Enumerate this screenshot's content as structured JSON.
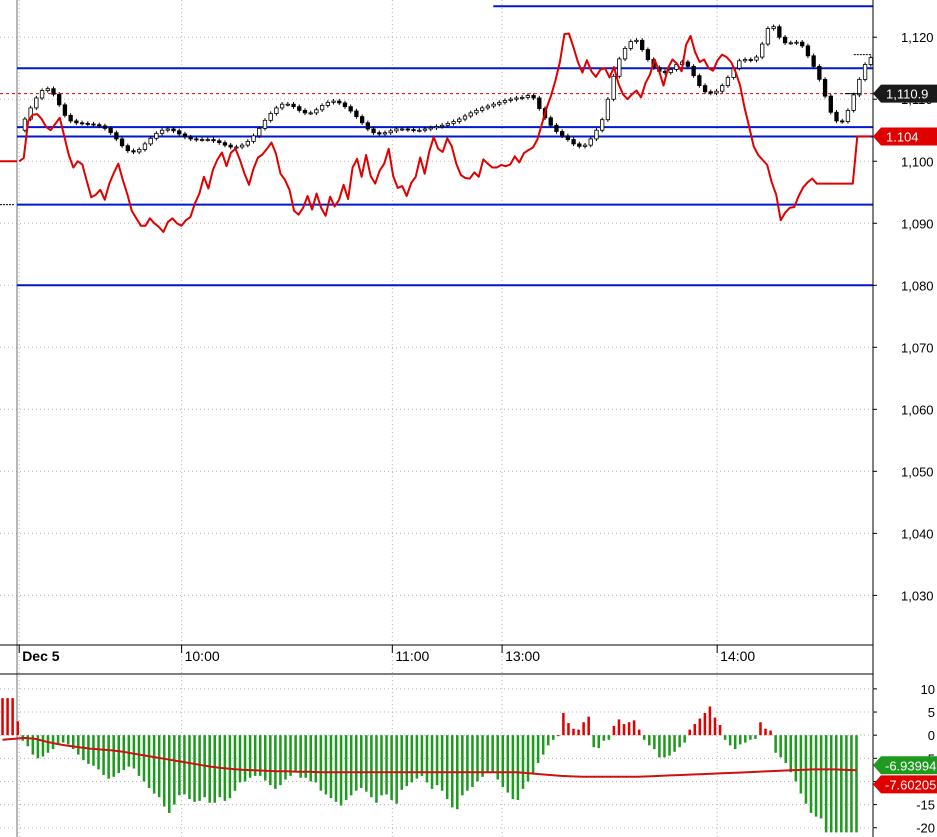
{
  "colors": {
    "background": "#ffffff",
    "grid": "#b8b8b8",
    "level_line": "#0018d0",
    "overlay_line": "#e00000",
    "candle_up": "#ffffff",
    "candle_down": "#000000",
    "histogram_positive": "#e00000",
    "histogram_negative": "#1e9a1e",
    "signal_line": "#d01010",
    "badge_dark": "#1a1a1a",
    "badge_red": "#e00000",
    "badge_green": "#1e9a1e",
    "text": "#000000"
  },
  "chart_data": [
    {
      "type": "candlestick",
      "panel": "price",
      "title": "",
      "xlabel": "",
      "ylabel": "",
      "ylim": [
        1022,
        1126
      ],
      "grid": true,
      "y_ticks": [
        1030,
        1040,
        1050,
        1060,
        1070,
        1080,
        1090,
        1100,
        1110,
        1120
      ],
      "y_tick_labels": [
        "1,030",
        "1,040",
        "1,050",
        "1,060",
        "1,070",
        "1,080",
        "1,090",
        "1,100",
        "1,110",
        "1,120"
      ],
      "x_tick_labels": [
        {
          "label": "Dec 5",
          "bar": 0
        },
        {
          "label": "10:00",
          "bar": 37
        },
        {
          "label": "11:00",
          "bar": 85
        },
        {
          "label": "13:00",
          "bar": 110
        },
        {
          "label": "14:00",
          "bar": 159
        }
      ],
      "bar_count": 195,
      "candles": {
        "bar_start": 0,
        "values": [
          1105.0,
          1106.8,
          1108.6,
          1110.2,
          1111.4,
          1111.7,
          1110.8,
          1109.1,
          1107.4,
          1106.5,
          1106.2,
          1106.1,
          1106.0,
          1105.9,
          1105.7,
          1105.3,
          1104.6,
          1103.6,
          1102.5,
          1101.7,
          1101.5,
          1101.9,
          1102.8,
          1103.7,
          1104.5,
          1105.0,
          1105.2,
          1104.9,
          1104.4,
          1103.9,
          1103.6,
          1103.5,
          1103.5,
          1103.5,
          1103.3,
          1103.0,
          1102.6,
          1102.3,
          1102.3,
          1102.6,
          1103.2,
          1104.1,
          1105.3,
          1106.6,
          1107.7,
          1108.6,
          1109.2,
          1109.2,
          1108.8,
          1108.2,
          1107.8,
          1107.8,
          1108.3,
          1109.0,
          1109.5,
          1109.7,
          1109.4,
          1108.8,
          1108.1,
          1107.2,
          1106.2,
          1105.2,
          1104.6,
          1104.4,
          1104.6,
          1104.9,
          1105.2,
          1105.2,
          1105.1,
          1105.0,
          1105.0,
          1105.2,
          1105.4,
          1105.6,
          1105.8,
          1106.1,
          1106.4,
          1106.8,
          1107.3,
          1107.8,
          1108.2,
          1108.6,
          1108.9,
          1109.2,
          1109.5,
          1109.8,
          1110.0,
          1110.2,
          1110.3,
          1110.6,
          1110.2,
          1108.5,
          1107.0,
          1105.8,
          1104.8,
          1104.1,
          1103.5,
          1102.8,
          1102.4,
          1102.6,
          1103.6,
          1105.0,
          1106.7,
          1110.0,
          1113.7,
          1116.5,
          1118.2,
          1119.3,
          1119.5,
          1118.0,
          1116.4,
          1115.1,
          1114.5,
          1114.3,
          1114.8,
          1115.6,
          1116.0,
          1115.3,
          1113.8,
          1112.2,
          1111.2,
          1111.0,
          1111.3,
          1112.2,
          1113.5,
          1115.0,
          1116.2,
          1116.4,
          1116.3,
          1116.8,
          1118.9,
          1121.4,
          1121.7,
          1120.0,
          1119.1,
          1119.1,
          1119.2,
          1118.6,
          1117.0,
          1115.3,
          1113.2,
          1110.5,
          1107.9,
          1106.5,
          1106.4,
          1108.2,
          1110.7,
          1113.2,
          1115.6,
          1116.7
        ],
        "bar_end": 194
      },
      "red_line": {
        "bar_start": 0,
        "values": [
          1100.0,
          1100.5,
          1106.5,
          1107.5,
          1107.6,
          1106.8,
          1105.5,
          1105.0,
          1106.0,
          1107.0,
          1104.0,
          1101.0,
          1099.0,
          1100.0,
          1099.5,
          1096.8,
          1094.2,
          1094.6,
          1095.4,
          1093.8,
          1096.4,
          1098.1,
          1099.6,
          1097.0,
          1094.7,
          1092.0,
          1090.8,
          1089.6,
          1089.6,
          1090.8,
          1090.0,
          1089.4,
          1088.6,
          1090.2,
          1090.8,
          1090.0,
          1089.6,
          1090.5,
          1091.0,
          1093.2,
          1094.8,
          1097.5,
          1095.6,
          1098.6,
          1100.3,
          1101.4,
          1099.2,
          1101.4,
          1102.0,
          1100.2,
          1098.0,
          1096.2,
          1098.8,
          1100.6,
          1101.1,
          1102.0,
          1103.0,
          1101.2,
          1098.0,
          1097.0,
          1095.4,
          1092.0,
          1091.4,
          1092.5,
          1094.4,
          1092.2,
          1094.8,
          1092.5,
          1091.2,
          1094.3,
          1092.7,
          1093.8,
          1096.2,
          1093.9,
          1099.0,
          1100.4,
          1097.5,
          1101.0,
          1097.6,
          1096.4,
          1098.5,
          1099.6,
          1102.0,
          1097.6,
          1095.7,
          1096.0,
          1094.4,
          1096.5,
          1097.5,
          1100.6,
          1098.0,
          1101.5,
          1103.9,
          1102.0,
          1101.5,
          1103.7,
          1102.4,
          1099.6,
          1097.8,
          1097.3,
          1097.2,
          1098.2,
          1097.5,
          1100.3,
          1099.6,
          1099.0,
          1099.0,
          1099.4,
          1099.2,
          1099.5,
          1100.8,
          1099.8,
          1101.3,
          1101.8,
          1102.2,
          1103.5,
          1106.0,
          1108.5,
          1110.5,
          1113.0,
          1116.0,
          1120.5,
          1120.6,
          1118.4,
          1116.0,
          1114.3,
          1116.3,
          1114.5,
          1113.6,
          1114.8,
          1115.0,
          1113.5,
          1115.2,
          1112.5,
          1110.8,
          1110.0,
          1110.8,
          1111.4,
          1110.3,
          1112.6,
          1114.0,
          1116.4,
          1114.6,
          1112.2,
          1115.0,
          1116.4,
          1115.7,
          1114.5,
          1118.8,
          1120.2,
          1117.6,
          1116.0,
          1116.4,
          1115.0,
          1114.6,
          1116.3,
          1117.2,
          1116.8,
          1116.0,
          1114.4,
          1112.2,
          1108.6,
          1105.6,
          1102.4,
          1101.0,
          1100.2,
          1099.4,
          1096.6,
          1094.6,
          1090.5,
          1091.7,
          1092.5,
          1092.6,
          1094.4,
          1095.8,
          1096.6,
          1097.2,
          1096.4,
          1096.4,
          1096.4,
          1096.4,
          1096.4,
          1096.4,
          1096.4,
          1096.4,
          1096.4,
          1104.0,
          1104.0,
          1104.0,
          1104.0
        ],
        "bar_end": 194
      },
      "horizontal_lines": [
        {
          "value": 1125.0,
          "from_bar": 108
        },
        {
          "value": 1115.0,
          "from_bar": 2
        },
        {
          "value": 1105.5,
          "from_bar": 2
        },
        {
          "value": 1104.0,
          "from_bar": 2
        },
        {
          "value": 1093.0,
          "from_bar": 2
        },
        {
          "value": 1080.0,
          "from_bar": 2
        }
      ],
      "dashed_reference": {
        "value": 1110.9
      },
      "value_labels": [
        {
          "text": "1,110.9",
          "value": 1110.9,
          "style": "dark"
        },
        {
          "text": "1.104",
          "value": 1104.0,
          "style": "red"
        }
      ]
    },
    {
      "type": "histogram",
      "panel": "oscillator",
      "title": "",
      "ylim": [
        -22,
        13
      ],
      "grid": true,
      "y_ticks": [
        10,
        5,
        0,
        -5,
        -10,
        -15,
        -20
      ],
      "y_tick_labels": [
        "10",
        "5",
        "0",
        "5",
        "10",
        "-15",
        "-20"
      ],
      "bar_count": 195,
      "histogram": [
        8.0,
        8.0,
        8.0,
        3.0,
        -1.2,
        -2.4,
        -4.2,
        -5.0,
        -4.6,
        -3.8,
        -3.0,
        -2.1,
        -1.6,
        -2.0,
        -3.0,
        -4.2,
        -5.4,
        -6.2,
        -6.6,
        -7.4,
        -8.6,
        -9.4,
        -9.0,
        -8.2,
        -7.5,
        -6.8,
        -7.2,
        -8.8,
        -10.0,
        -11.4,
        -12.6,
        -13.4,
        -15.4,
        -16.8,
        -15.0,
        -13.0,
        -12.8,
        -13.8,
        -14.4,
        -14.2,
        -13.4,
        -14.6,
        -14.6,
        -13.4,
        -14.2,
        -13.6,
        -12.0,
        -10.2,
        -10.0,
        -9.2,
        -8.8,
        -8.8,
        -9.8,
        -10.8,
        -11.6,
        -10.8,
        -9.6,
        -8.8,
        -7.8,
        -9.2,
        -9.2,
        -10.0,
        -10.2,
        -12.0,
        -12.8,
        -13.6,
        -14.4,
        -15.2,
        -14.0,
        -13.0,
        -12.0,
        -11.4,
        -12.2,
        -13.4,
        -14.6,
        -13.0,
        -12.8,
        -14.0,
        -14.8,
        -11.8,
        -11.0,
        -10.2,
        -9.4,
        -8.8,
        -10.2,
        -11.6,
        -10.8,
        -12.0,
        -13.8,
        -15.6,
        -16.0,
        -13.0,
        -12.0,
        -11.2,
        -10.0,
        -9.0,
        -8.2,
        -8.0,
        -9.6,
        -11.2,
        -12.4,
        -13.8,
        -14.0,
        -11.6,
        -10.0,
        -8.4,
        -6.0,
        -4.2,
        -2.2,
        -1.0,
        0.0,
        4.8,
        2.6,
        1.4,
        1.2,
        2.8,
        4.0,
        -2.6,
        -2.8,
        -1.2,
        -1.0,
        2.0,
        3.4,
        2.4,
        2.8,
        3.2,
        1.2,
        -1.0,
        -2.2,
        -3.0,
        -4.8,
        -4.8,
        -4.4,
        -3.6,
        -2.6,
        -1.6,
        1.2,
        2.4,
        3.6,
        4.8,
        6.2,
        3.8,
        2.2,
        -1.0,
        -2.2,
        -3.0,
        -2.0,
        -1.6,
        -1.0,
        -0.8,
        2.8,
        1.4,
        1.0,
        -3.8,
        -4.8,
        -6.0,
        -8.0,
        -10.0,
        -12.6,
        -14.8,
        -16.8,
        -17.6,
        -18.0,
        -21.0,
        -21.0,
        -21.0,
        -21.0,
        -21.0,
        -21.0,
        -21.0
      ],
      "signal_line": [
        -1.0,
        -0.8,
        -0.6,
        -0.8,
        -1.4,
        -1.9,
        -2.3,
        -2.6,
        -2.9,
        -3.1,
        -3.3,
        -3.6,
        -4.0,
        -4.4,
        -4.8,
        -5.2,
        -5.6,
        -6.0,
        -6.4,
        -6.8,
        -7.1,
        -7.3,
        -7.5,
        -7.6,
        -7.7,
        -7.8,
        -7.8,
        -7.9,
        -7.9,
        -8.0,
        -8.0,
        -8.0,
        -8.0,
        -8.0,
        -8.0,
        -8.0,
        -8.0,
        -8.0,
        -8.0,
        -8.0,
        -8.0,
        -8.0,
        -8.0,
        -8.0,
        -8.0,
        -8.0,
        -8.0,
        -8.0,
        -8.2,
        -8.4,
        -8.6,
        -8.8,
        -8.9,
        -9.0,
        -9.0,
        -9.0,
        -9.0,
        -9.0,
        -9.0,
        -8.9,
        -8.8,
        -8.7,
        -8.6,
        -8.5,
        -8.4,
        -8.3,
        -8.2,
        -8.1,
        -8.0,
        -7.9,
        -7.8,
        -7.7,
        -7.6,
        -7.5,
        -7.4,
        -7.4,
        -7.4,
        -7.5,
        -7.6
      ],
      "value_labels": [
        {
          "text": "-6.93994",
          "value": -6.94,
          "style": "green"
        },
        {
          "text": "-7.60205",
          "value": -7.6,
          "style": "red"
        }
      ]
    }
  ]
}
